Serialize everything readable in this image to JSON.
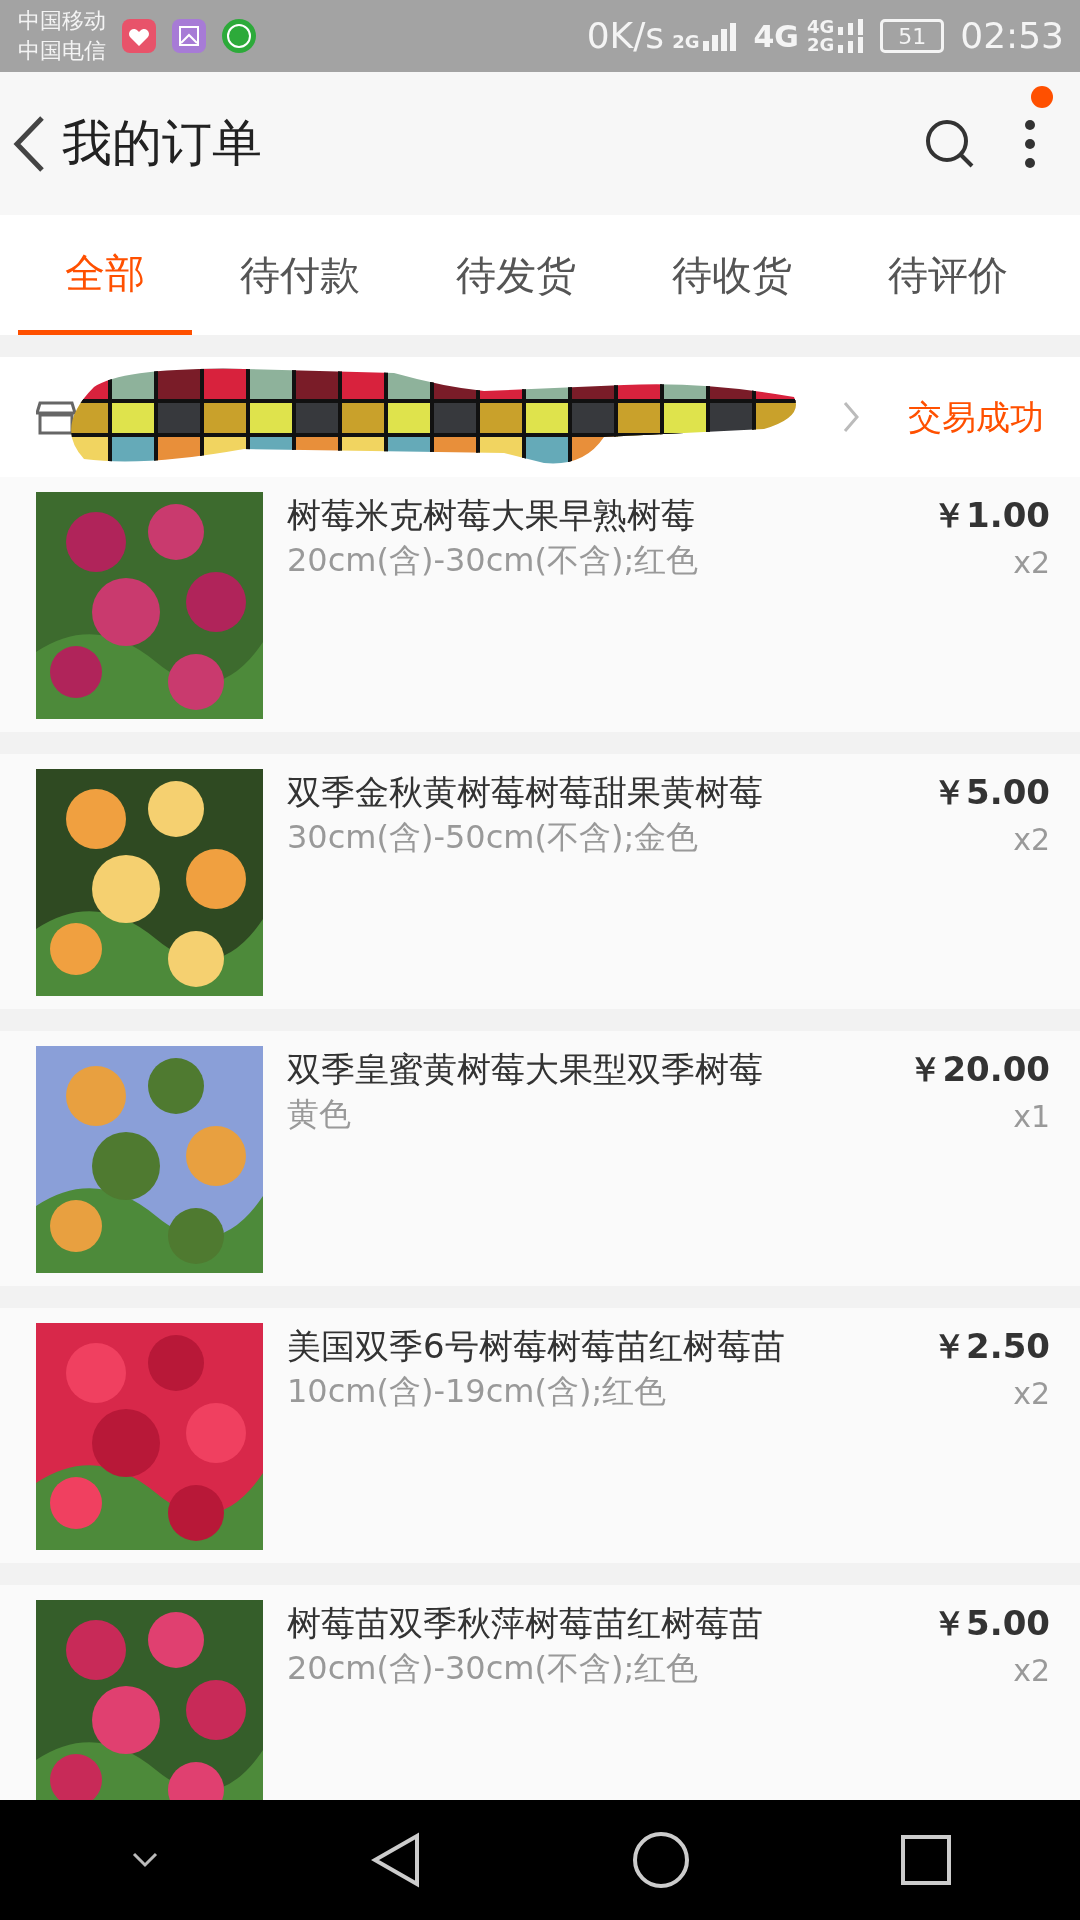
{
  "status_bar": {
    "carriers": [
      "中国移动",
      "中国电信"
    ],
    "speed": "0K/s",
    "network_1": "2G",
    "network_2": "4G",
    "network_3": "4G",
    "network_4": "2G",
    "battery": "51",
    "time": "02:53"
  },
  "header": {
    "title": "我的订单",
    "notification_dot": true
  },
  "tabs": [
    {
      "label": "全部",
      "selected": true
    },
    {
      "label": "待付款",
      "selected": false
    },
    {
      "label": "待发货",
      "selected": false
    },
    {
      "label": "待收货",
      "selected": false
    },
    {
      "label": "待评价",
      "selected": false
    }
  ],
  "order": {
    "status": "交易成功",
    "items": [
      {
        "title": "树莓米克树莓大果早熟树莓",
        "spec": "20cm(含)-30cm(不含);红色",
        "price": "￥1.00",
        "quantity": "x2"
      },
      {
        "title": "双季金秋黄树莓树莓甜果黄树莓",
        "spec": "30cm(含)-50cm(不含);金色",
        "price": "￥5.00",
        "quantity": "x2"
      },
      {
        "title": "双季皇蜜黄树莓大果型双季树莓",
        "spec": "黄色",
        "price": "￥20.00",
        "quantity": "x1"
      },
      {
        "title": "美国双季6号树莓树莓苗红树莓苗",
        "spec": "10cm(含)-19cm(含);红色",
        "price": "￥2.50",
        "quantity": "x2"
      },
      {
        "title": "树莓苗双季秋萍树莓苗红树莓苗",
        "spec": "20cm(含)-30cm(不含);红色",
        "price": "￥5.00",
        "quantity": "x2"
      }
    ]
  }
}
